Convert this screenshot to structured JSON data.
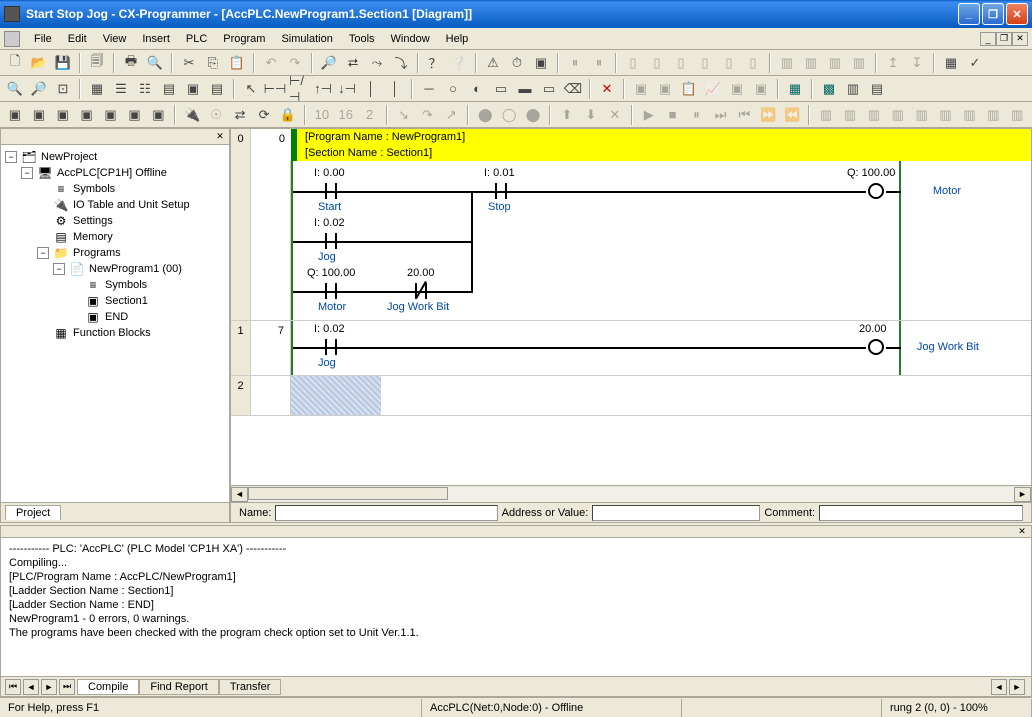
{
  "title": "Start Stop Jog - CX-Programmer - [AccPLC.NewProgram1.Section1 [Diagram]]",
  "menu": {
    "file": "File",
    "edit": "Edit",
    "view": "View",
    "insert": "Insert",
    "plc": "PLC",
    "program": "Program",
    "simulation": "Simulation",
    "tools": "Tools",
    "window": "Window",
    "help": "Help"
  },
  "tree": {
    "root": "NewProject",
    "plc": "AccPLC[CP1H] Offline",
    "symbols": "Symbols",
    "io": "IO Table and Unit Setup",
    "settings": "Settings",
    "memory": "Memory",
    "programs": "Programs",
    "newprogram": "NewProgram1 (00)",
    "progsymbols": "Symbols",
    "section1": "Section1",
    "end": "END",
    "functionblocks": "Function Blocks",
    "tab": "Project"
  },
  "ladder": {
    "programName": "[Program Name : NewProgram1]",
    "sectionName": "[Section Name : Section1]",
    "rung0": {
      "num": "0",
      "step": "0",
      "c1": {
        "addr": "I: 0.00",
        "lbl": "Start"
      },
      "c2": {
        "addr": "I: 0.01",
        "lbl": "Stop"
      },
      "c3": {
        "addr": "I: 0.02",
        "lbl": "Jog"
      },
      "c4": {
        "addr": "Q: 100.00",
        "lbl": "Motor"
      },
      "c5": {
        "addr": "20.00",
        "lbl": "Jog Work Bit"
      },
      "out": {
        "addr": "Q: 100.00",
        "lbl": "Motor"
      }
    },
    "rung1": {
      "num": "1",
      "step": "7",
      "c1": {
        "addr": "I: 0.02",
        "lbl": "Jog"
      },
      "out": {
        "addr": "20.00",
        "lbl": "Jog Work Bit"
      }
    },
    "rung2": {
      "num": "2"
    }
  },
  "strip": {
    "name": "Name:",
    "addr": "Address or Value:",
    "comment": "Comment:"
  },
  "output": {
    "lines": [
      "----------- PLC: 'AccPLC' (PLC Model 'CP1H XA') -----------",
      "Compiling...",
      "[PLC/Program Name : AccPLC/NewProgram1]",
      "[Ladder Section Name : Section1]",
      "[Ladder Section Name : END]",
      "",
      "NewProgram1 - 0 errors, 0 warnings.",
      "The programs have been checked with the program check option set to Unit Ver.1.1."
    ],
    "tab1": "Compile",
    "tab2": "Find Report",
    "tab3": "Transfer"
  },
  "status": {
    "help": "For Help, press F1",
    "plc": "AccPLC(Net:0,Node:0) - Offline",
    "rung": "rung 2 (0, 0)  - 100%"
  }
}
